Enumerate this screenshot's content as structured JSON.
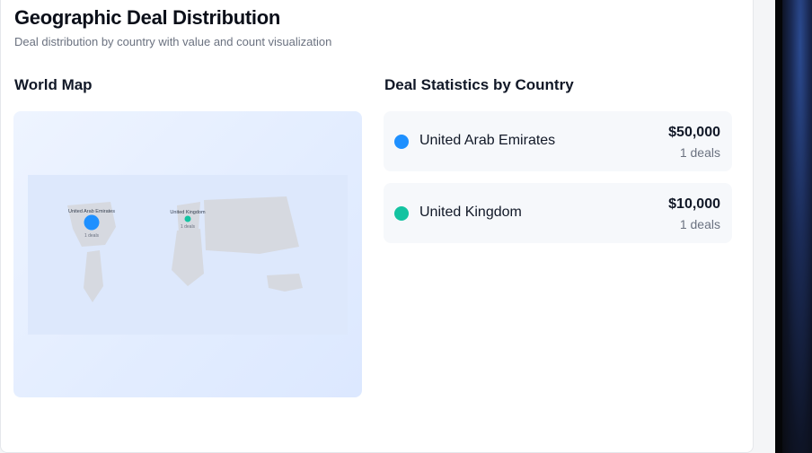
{
  "header": {
    "title": "Geographic Deal Distribution",
    "subtitle": "Deal distribution by country with value and count visualization"
  },
  "map": {
    "section_title": "World Map",
    "markers": [
      {
        "label": "United Arab Emirates",
        "count_label": "1 deals",
        "color": "#1e90ff"
      },
      {
        "label": "United Kingdom",
        "count_label": "1 deals",
        "color": "#14c3a1"
      }
    ]
  },
  "stats": {
    "section_title": "Deal Statistics by Country",
    "rows": [
      {
        "country": "United Arab Emirates",
        "value": "$50,000",
        "count": "1 deals",
        "color": "#1e90ff"
      },
      {
        "country": "United Kingdom",
        "value": "$10,000",
        "count": "1 deals",
        "color": "#14c3a1"
      }
    ]
  },
  "colors": {
    "land": "#d6d9e0",
    "map_bg": "#dce8ff"
  }
}
